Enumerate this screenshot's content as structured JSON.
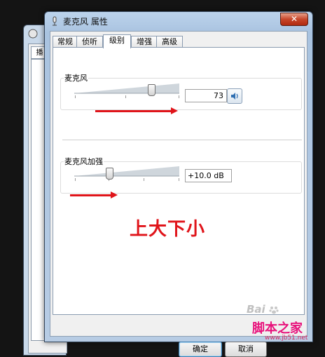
{
  "window": {
    "title": "麦克风 属性",
    "close_label": "✕"
  },
  "tabs": [
    {
      "label": "常规",
      "active": false
    },
    {
      "label": "侦听",
      "active": false
    },
    {
      "label": "级别",
      "active": true
    },
    {
      "label": "增强",
      "active": false
    },
    {
      "label": "高级",
      "active": false
    }
  ],
  "background_window": {
    "tab_label": "播"
  },
  "microphone": {
    "label": "麦克风",
    "level": 73,
    "value_text": "73",
    "slider_fraction": 0.73
  },
  "boost": {
    "label": "麦克风加强",
    "value_text": "+10.0 dB",
    "slider_fraction": 0.33
  },
  "annotation": {
    "note": "上大下小",
    "arrow_color": "#e0141a"
  },
  "buttons": {
    "ok": "确定",
    "cancel": "取消"
  },
  "watermarks": {
    "baidu": "Bai",
    "jiaoben": "脚本之家",
    "url": "www.jb51.net"
  },
  "colors": {
    "accent": "#e0141a",
    "close": "#c7462a"
  }
}
